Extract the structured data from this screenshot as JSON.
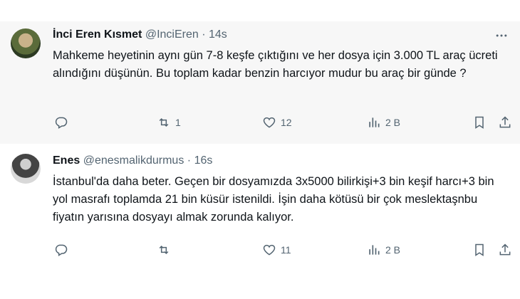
{
  "tweets": [
    {
      "name": "İnci Eren Kısmet",
      "handle": "@InciEren",
      "dot": "·",
      "time": "14s",
      "text": "Mahkeme heyetinin aynı gün 7-8 keşfe çıktığını ve her  dosya için 3.000 TL araç ücreti alındığını düşünün. Bu toplam kadar benzin harcıyor mudur bu araç bir günde ?",
      "retweets": "1",
      "likes": "12",
      "views": "2 B"
    },
    {
      "name": "Enes",
      "handle": "@enesmalikdurmus",
      "dot": "·",
      "time": "16s",
      "text": "İstanbul'da daha beter. Geçen bir dosyamızda 3x5000 bilirkişi+3 bin keşif harcı+3 bin yol masrafı toplamda 21 bin küsür istenildi. İşin daha kötüsü bir çok meslektaşnbu fiyatın yarısına dosyayı almak zorunda kalıyor.",
      "retweets": "",
      "likes": "11",
      "views": "2 B"
    }
  ],
  "icons": {
    "more": "more-horizontal-icon",
    "reply": "reply-icon",
    "retweet": "retweet-icon",
    "like": "heart-icon",
    "views": "views-chart-icon",
    "bookmark": "bookmark-icon",
    "share": "share-icon"
  },
  "colors": {
    "secondary_text": "#536471",
    "primary_text": "#0f1419",
    "highlight_bg": "#f7f7f7"
  }
}
